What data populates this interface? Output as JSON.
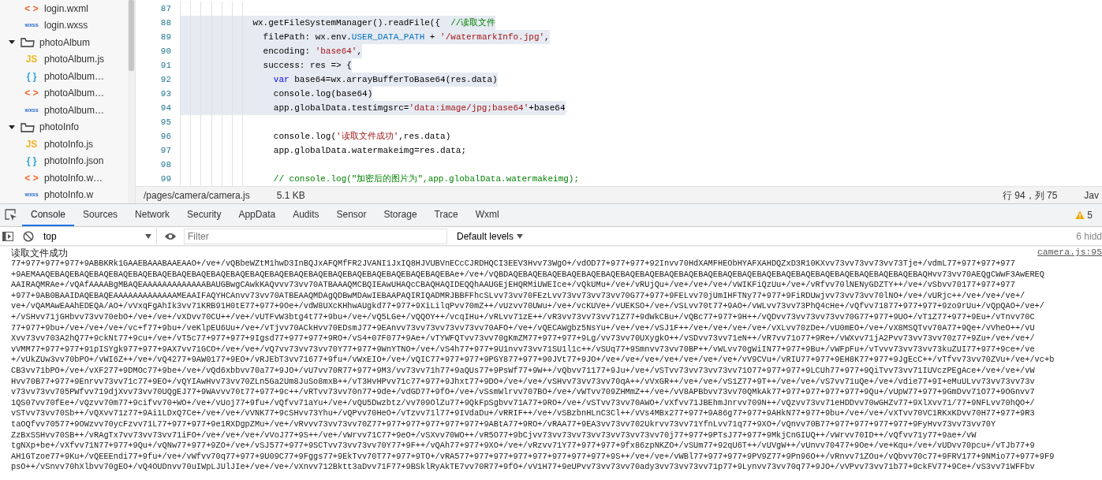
{
  "sidebar": {
    "items": [
      {
        "label": "login.wxml",
        "kind": "wxml",
        "icon_text": "< >"
      },
      {
        "label": "login.wxss",
        "kind": "wxss",
        "icon_text": "wxss"
      },
      {
        "label": "photoAlbum",
        "kind": "folder",
        "expanded": true,
        "children": [
          {
            "label": "photoAlbum.js",
            "kind": "js",
            "icon_text": "JS"
          },
          {
            "label": "photoAlbum…",
            "kind": "json",
            "icon_text": "{ }"
          },
          {
            "label": "photoAlbum…",
            "kind": "wxml",
            "icon_text": "< >"
          },
          {
            "label": "photoAlbum…",
            "kind": "wxss",
            "icon_text": "wxss"
          }
        ]
      },
      {
        "label": "photoInfo",
        "kind": "folder",
        "expanded": true,
        "children": [
          {
            "label": "photoInfo.js",
            "kind": "js",
            "icon_text": "JS"
          },
          {
            "label": "photoInfo.json",
            "kind": "json",
            "icon_text": "{ }"
          },
          {
            "label": "photoInfo.w…",
            "kind": "wxml",
            "icon_text": "< >"
          },
          {
            "label": "photoInfo.w",
            "kind": "wxss",
            "icon_text": "wxss"
          }
        ]
      }
    ]
  },
  "editor": {
    "lines": [
      {
        "number": "87",
        "highlighted": false
      },
      {
        "number": "88",
        "highlighted": true,
        "tokens": [
          {
            "t": "              wx.getFileSystemManager().readFile({  ",
            "kind": "plain"
          },
          {
            "t": "//读取文件",
            "kind": "comment"
          }
        ]
      },
      {
        "number": "89",
        "highlighted": true,
        "tokens": [
          {
            "t": "                filePath: wx.env.",
            "kind": "plain"
          },
          {
            "t": "USER_DATA_PATH",
            "kind": "constant"
          },
          {
            "t": " + ",
            "kind": "plain"
          },
          {
            "t": "'/watermarkInfo.jpg'",
            "kind": "string"
          },
          {
            "t": ",",
            "kind": "plain"
          }
        ]
      },
      {
        "number": "90",
        "highlighted": true,
        "tokens": [
          {
            "t": "                encoding: ",
            "kind": "plain"
          },
          {
            "t": "'base64'",
            "kind": "string"
          },
          {
            "t": ",",
            "kind": "plain"
          }
        ]
      },
      {
        "number": "91",
        "highlighted": true,
        "tokens": [
          {
            "t": "                success: res => {",
            "kind": "plain"
          }
        ]
      },
      {
        "number": "92",
        "highlighted": true,
        "tokens": [
          {
            "t": "                  var",
            "kind": "keyword"
          },
          {
            "t": " base64=wx.arrayBufferToBase64(res.data)",
            "kind": "plain"
          }
        ]
      },
      {
        "number": "93",
        "highlighted": true,
        "tokens": [
          {
            "t": "                  console.log(base64)",
            "kind": "plain"
          }
        ]
      },
      {
        "number": "94",
        "highlighted": true,
        "tokens": [
          {
            "t": "                  app.globalData.testimgsrc=",
            "kind": "plain"
          },
          {
            "t": "'data:image/jpg;base64'",
            "kind": "string"
          },
          {
            "t": "+base64",
            "kind": "plain"
          }
        ]
      },
      {
        "number": "95",
        "highlighted": false
      },
      {
        "number": "96",
        "highlighted": false,
        "tokens": [
          {
            "t": "                  console.log(",
            "kind": "plain"
          },
          {
            "t": "'读取文件成功'",
            "kind": "string"
          },
          {
            "t": ",res.data)",
            "kind": "plain"
          }
        ]
      },
      {
        "number": "97",
        "highlighted": false,
        "tokens": [
          {
            "t": "                  app.globalData.watermakeimg=res.data;",
            "kind": "plain"
          }
        ]
      },
      {
        "number": "98",
        "highlighted": false
      },
      {
        "number": "99",
        "highlighted": false,
        "tokens": [
          {
            "t": "                  // console.log(\"加密后的图片为\",app.globalData.watermakeimg);",
            "kind": "comment"
          }
        ]
      }
    ]
  },
  "editor_status": {
    "path": "/pages/camera/camera.js",
    "size": "5.1 KB",
    "position": "行 94，列 75",
    "language": "Jav"
  },
  "devtools": {
    "tabs": [
      {
        "label": "Console",
        "selected": true
      },
      {
        "label": "Sources",
        "selected": false
      },
      {
        "label": "Network",
        "selected": false
      },
      {
        "label": "Security",
        "selected": false
      },
      {
        "label": "AppData",
        "selected": false
      },
      {
        "label": "Audits",
        "selected": false
      },
      {
        "label": "Sensor",
        "selected": false
      },
      {
        "label": "Storage",
        "selected": false
      },
      {
        "label": "Trace",
        "selected": false
      },
      {
        "label": "Wxml",
        "selected": false
      }
    ],
    "warnings": "5"
  },
  "console_toolbar": {
    "context": "top",
    "filter_placeholder": "Filter",
    "levels": "Default levels",
    "hidden": "6 hidd"
  },
  "console": {
    "message": "读取文件成功",
    "source": "camera.js:95",
    "lines": [
      "77+977+977+977+9ABBKRk1GAAEBAAABAAEAAO+/ve+/vQBbeWZtM1hwD3InBQJxAFQMfFR2JVANI1JxIQ8HJVUBVnECcCJRDHQCI3EEV3Hvv73WgO+/vdOD77+977+977+92Invv70HdXAMFHEObHYAFXAHDQZxD3R10KXvv73vv73vv73vv73Tje+/vdmL77+977+977+977",
      "+9AEMAAQEBAQEBAQEBAQEBAQEBAQEBAQEBAQEBAQEBAQEBAQEBAQEBAQEBAQEBAQEBAQEBAQEBAQEBAQEBAQEBAQEBAe+/ve+/vQBDAQEBAQEBAQEBAQEBAQEBAQEBAQEBAQEBAQEBAQEBAQEBAQEBAQEBAQEBAQEBAQEBAQEBAQEBAQEBAQEBAQEBAQHvv73vv70AEQgCWwF3AwEREQ",
      "AAIRAQMRAe+/vQAfAAAABgMBAQEAAAAAAAAAAAAABAUGBwgCAwkKAQvvv73vv70ATBAAAQMCBQIEAwUHAQcCBAQHAQIDEQQhAAUGEjEHQRMiUWEIce+/vQkUMu+/ve+/vRUjQu+/ve+/ve+/ve+/vWIKFiQzUu+/ve+/vRfvv70lNENyGDZTY++/ve+/vSbvv70177+977+977",
      "+977+9AB0BAAIDAQEBAQEAAAAAAAAAAAAAMEAAIFAQYHCAnvv73vv70ATBEAAQMDAgQDBwMDAwIEBAAPAQIRIQADMRJBBFFhcSLvv73vv70FEzLvv73vv73vv73vv70G77+977+9FELvv70jUmIHFTNy77+977+9FiRDUwjvv73vv73vv70lNO+/ve+/vURjc++/ve+/ve+/ve+/",
      "ve+/vQAMAwEAAhEDEQA/AO+/vVxqFgAhIk3vv71KRB91H0tE77+977+9Oe+/vdW8UXcKHhwAUgkd77+977+9XiLilqPvv70mZ++/vUzvv70UWu+/ve+/vcKUVe+/vUEKSO+/ve+/vSLvv70t77+9AO+/vWLvv73vv73PhQ4cHe+/vQfvv71877+977+977+9zo9rUu+/vQpQAO+/ve+/",
      "+/vSHvv71jGHbvv73vv70ebO+/ve+/ve+/vXDvv70CU++/ve+/vUTFvW3btg4t77+9bu+/ve+/vQ5LGe+/vQQOY++/vcqIHu+/vRLvv71zE++/vR3vv73vv73vv71Z77+9dWkCBu+/vQBc77+977+9H++/vQDvv73vv73vv73vv70G77+977+9UO+/vT1Z77+977+9Eu+/vTnvv70C",
      "77+977+9bu+/ve+/ve+/ve+/vc+f77+9bu+/veKlpEU6Uu+/ve+/vTjvv70ACkHvv70EDsmJ77+9EAnvv73vv73vv73vv73vv70AFO+/ve+/vQECAWgbz5NsYu+/ve+/ve+/vSJ1F++/ve+/ve+/ve+/ve+/vXLvv70zDe+/vU0mEO+/ve+/vX8MSQTvv70A77+9Qe+/vVheO++/vU",
      "Xvv73vv703A2hQ77+9ckNt77+9cu+/ve+/vT5c77+977+977+9Igsd77+977+977+9RO+/vS4+07F077+9Ae+/vTYWFQTvv73vv70gKmZM77+977+977+9Lg/vv73vv70UXygkO++/vSDvv73vv71eN++/vR7vv71o77+9Re+/vWXvv71jA2Pvv73vv73vv70z77+9Zu+/ve+/ve+/",
      "vVMM77+977+977+91pISYgk977+977+9AX7vv71GCO+/ve+/ve+/vQ7vv73vv73vv70Y77+977+9WnYTNO+/ve+/vS4h77+977+9U1nvv73vv71SU1l1c++/vSUq77+9Smnvv73vv70BP++/vWLvv70gWiIN77+977+9Bu+/vWFpFu+/vTvvv73vv73vv73kuZUI77+977+9ce+/ve",
      "+/vUkZUw3vv70bPO+/vWI6Z++/ve+/vQ4277+9AW0177+9EO+/vRJEbT3vv71677+9fu+/vWxEIO+/ve+/vQIC77+977+977+9PGY877+977+90JVt77+9JO+/ve+/ve+/ve+/ve+/ve+/ve+/ve+/vV9CVu+/vRIU77+977+9EH8K77+977+9JgEcC++/vTfvv73vv70ZVu+/ve+/vc+b",
      "CB3vv71bPO+/ve+/vXF277+9DMOc77+9be+/ve+/vQd6xbbvv70a77+9JO+/vU7vv70R77+977+9M3/vv73vv71h77+9aQUs77+9PsWf77+9W++/vQbvv71177+9Ju+/ve+/vSTvv73vv73vv73vv71O77+977+977+9LCUh77+977+9QiTvv73vv71IUVczPEgAce+/ve+/ve+/vW",
      "Hvv70B77+977+9Enrvv73vv71c77+9EO+/vQYIAwHvv73vv70ZLn5Ga2Um8JuSo8mxB++/vT3HvHPvv71c77+977+9Jhxt77+9DO+/ve+/ve+/vSHvv73vv73vv70qA++/vVxGR++/ve+/ve+/vS1Z77+9T++/ve+/ve+/vS7vv71uQe+/ve+/vdie77+9I+eMuULvv73vv73vv73v",
      "v73vv73vv705PWfvv719djXvv73vv70UQgEJ77+9WAvvv70t77+977+9c++/vRTvv73vv70n77+9de+/vdGD77+9fO+/ve+/vSsmWlrvv707BO+/ve+/vWTvv709ZHMmZ++/ve+/vV8APBbvv73vv70QMkAk77+977+977+977+977+9Qu+/vUpW77+977+9GmDvv71O77+9OGnvv7",
      "1QS07vv70fEe+/vQzvv70m77+9cifvv70+WO+/ve+/vUoj77+9fu+/vQfvv71aYu+/ve+/vQU5Dwzbtz/vv709OlZu77+9QkFpSgbvv71A77+9RO+/ve+/vSTvv73vv70AWO+/vXfvv71JBEhmJnrvv709N++/vQzvv73vv71eHDDvv70wGHZv77+9XlXvv71/77+9NFLvv70hQO+/",
      "vSTvv73vv70Sb++/vQXvv71z77+9Ai1LDxQ7Ce+/ve+/ve+/vVNK77+9cSHvv73Yhu+/vQPvv70HeO+/vTzvv71l77+9IVdaDu+/vRRIF++/ve+/vSBzbnHLnC3Cl++/vVs4MBx277+977+9A86g77+977+9AHkN77+977+9bu+/ve+/ve+/vXTvv70VC1RKxKDvv70H77+977+9R3",
      "taOQfvv70577+9OWzvv70ycFzvv71L77+977+977+9e1RXDgpZMu+/ve+/vRvvv73vv73vv70Z77+977+977+977+977+977+9ABtA77+9RO+/vRAA77+9EA3vv73vv702Ukrvv73vv71YfnLvv71q77+9XO+/vQnvv70B77+977+977+977+977+9FyHvv73vv73vv70Y",
      "ZzBxSSHvv70SB++/vRAgTx7vv73vv73vv71iFO+/ve+/ve+/ve+/vVoJ77+9S++/ve+/vWrvv71C77+9eO+/vSXvv70WO++/vR5O77+9bCjvv73vv73vv73vv73vv73vv73vv70j77+977+9PTsJ77+977+9MkjCnGIUQ++/vWrvv70ID++/vQfvv71y77+9ae+/vW",
      "tgNXp+be+/vXfvv71N77+977+9Qu+/vQNw77+977+9ZO+/ve+/vSJ577+977+9SCTvv73vv73vv70Y77+9F++/vQAh77+977+9XO+/ve+/vRzvv71Y77+977+977+9fx86zpNKZO+/vSUm77+92qU6T++/vUVgW++/vUnvv70477+9Oe+/ve+Kqu+/ve+/vUDvv70pcu+/vTJb77+9",
      "AH1GTzoe77+9Ku+/vQEEEndi77+9fu+/ve+/vWfvv70q77+977+9U09C77+9Fggs77+9EkTvv70T77+977+9TO+/vRA577+977+977+977+977+977+977+977+9S++/ve+/ve+/vWBl77+977+977+9PV9Z77+9Pn96O++/vRnvv71ZOu+/vQbvv70c77+9FRV177+9NMio77+977+9F9",
      "psO++/vSnvv70hXlbvv70gEO+/vQ4OUDnvv70uIWpLJUlJIe+/ve+/ve+/vXnvv712Bktt3aDvv71F77+9BSklRyAkTE7vv70R77+9fO+/vV1H77+9eUPvv73vv73vv70ady3vv73vv73vv71p77+9Lynvv73vv70q77+9JO+/vVPvv73vv71b77+9ckFV77+9Ce+/vS3vv71WFFbv"
    ]
  }
}
